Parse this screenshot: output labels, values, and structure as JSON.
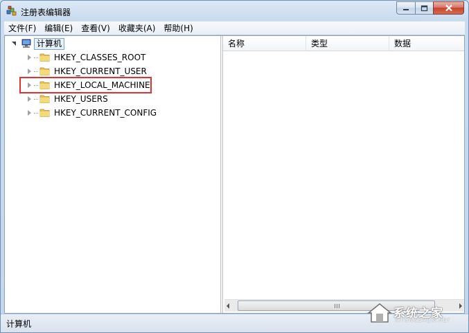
{
  "window": {
    "title": "注册表编辑器",
    "icon": "regedit-icon"
  },
  "menu": [
    "文件(F)",
    "编辑(E)",
    "查看(V)",
    "收藏夹(A)",
    "帮助(H)"
  ],
  "tree": {
    "root": "计算机",
    "children": [
      "HKEY_CLASSES_ROOT",
      "HKEY_CURRENT_USER",
      "HKEY_LOCAL_MACHINE",
      "HKEY_USERS",
      "HKEY_CURRENT_CONFIG"
    ],
    "highlighted_index": 2,
    "highlight_color": "#e0302f"
  },
  "list": {
    "columns": [
      "名称",
      "类型",
      "数据"
    ]
  },
  "status": "计算机",
  "scroll_grip": "III",
  "watermark": {
    "text": "系统之家",
    "sub": "XITONGZHIJIA.NET"
  }
}
